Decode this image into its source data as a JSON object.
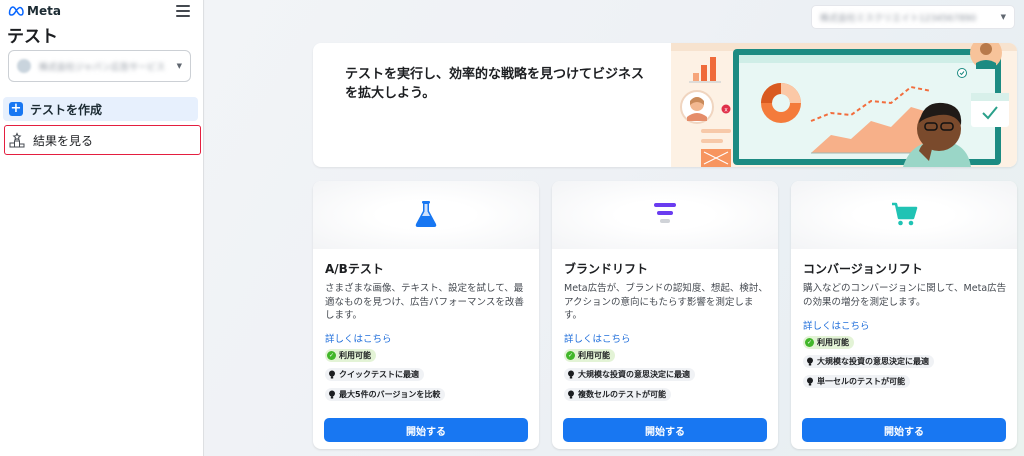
{
  "app": {
    "brand": "Meta",
    "page_title": "テスト"
  },
  "sidebar": {
    "account_name": "株式会社ジャパン広告サービス",
    "items": [
      {
        "label": "テストを作成"
      },
      {
        "label": "結果を見る"
      }
    ]
  },
  "header": {
    "account_id": "株式会社ミスクリエイト1234567890"
  },
  "banner": {
    "text": "テストを実行し、効率的な戦略を見つけてビジネスを拡大しよう。"
  },
  "cards": [
    {
      "title": "A/Bテスト",
      "description": "さまざまな画像、テキスト、設定を試して、最適なものを見つけ、広告パフォーマンスを改善します。",
      "link": "詳しくはこちら",
      "badge": "利用可能",
      "tips": [
        "クイックテストに最適",
        "最大5件のバージョンを比較"
      ],
      "button": "開始する"
    },
    {
      "title": "ブランドリフト",
      "description": "Meta広告が、ブランドの認知度、想起、検討、アクションの意向にもたらす影響を測定します。",
      "link": "詳しくはこちら",
      "badge": "利用可能",
      "tips": [
        "大規模な投資の意思決定に最適",
        "複数セルのテストが可能"
      ],
      "button": "開始する"
    },
    {
      "title": "コンバージョンリフト",
      "description": "購入などのコンバージョンに関して、Meta広告の効果の増分を測定します。",
      "link": "詳しくはこちら",
      "badge": "利用可能",
      "tips": [
        "大規模な投資の意思決定に最適",
        "単一セルのテストが可能"
      ],
      "button": "開始する"
    }
  ],
  "colors": {
    "accent": "#1877f2",
    "link": "#216fdb",
    "available": "#42b72a",
    "highlight_border": "#e41e3f"
  },
  "icons": {
    "logo": "meta-logo-icon",
    "menu": "hamburger-menu-icon",
    "create": "plus-icon",
    "results": "results-podium-icon",
    "card_icons": [
      "flask-icon",
      "filter-lines-icon",
      "shopping-cart-icon"
    ],
    "badge": "check-circle-icon",
    "tip": "lightbulb-icon"
  }
}
